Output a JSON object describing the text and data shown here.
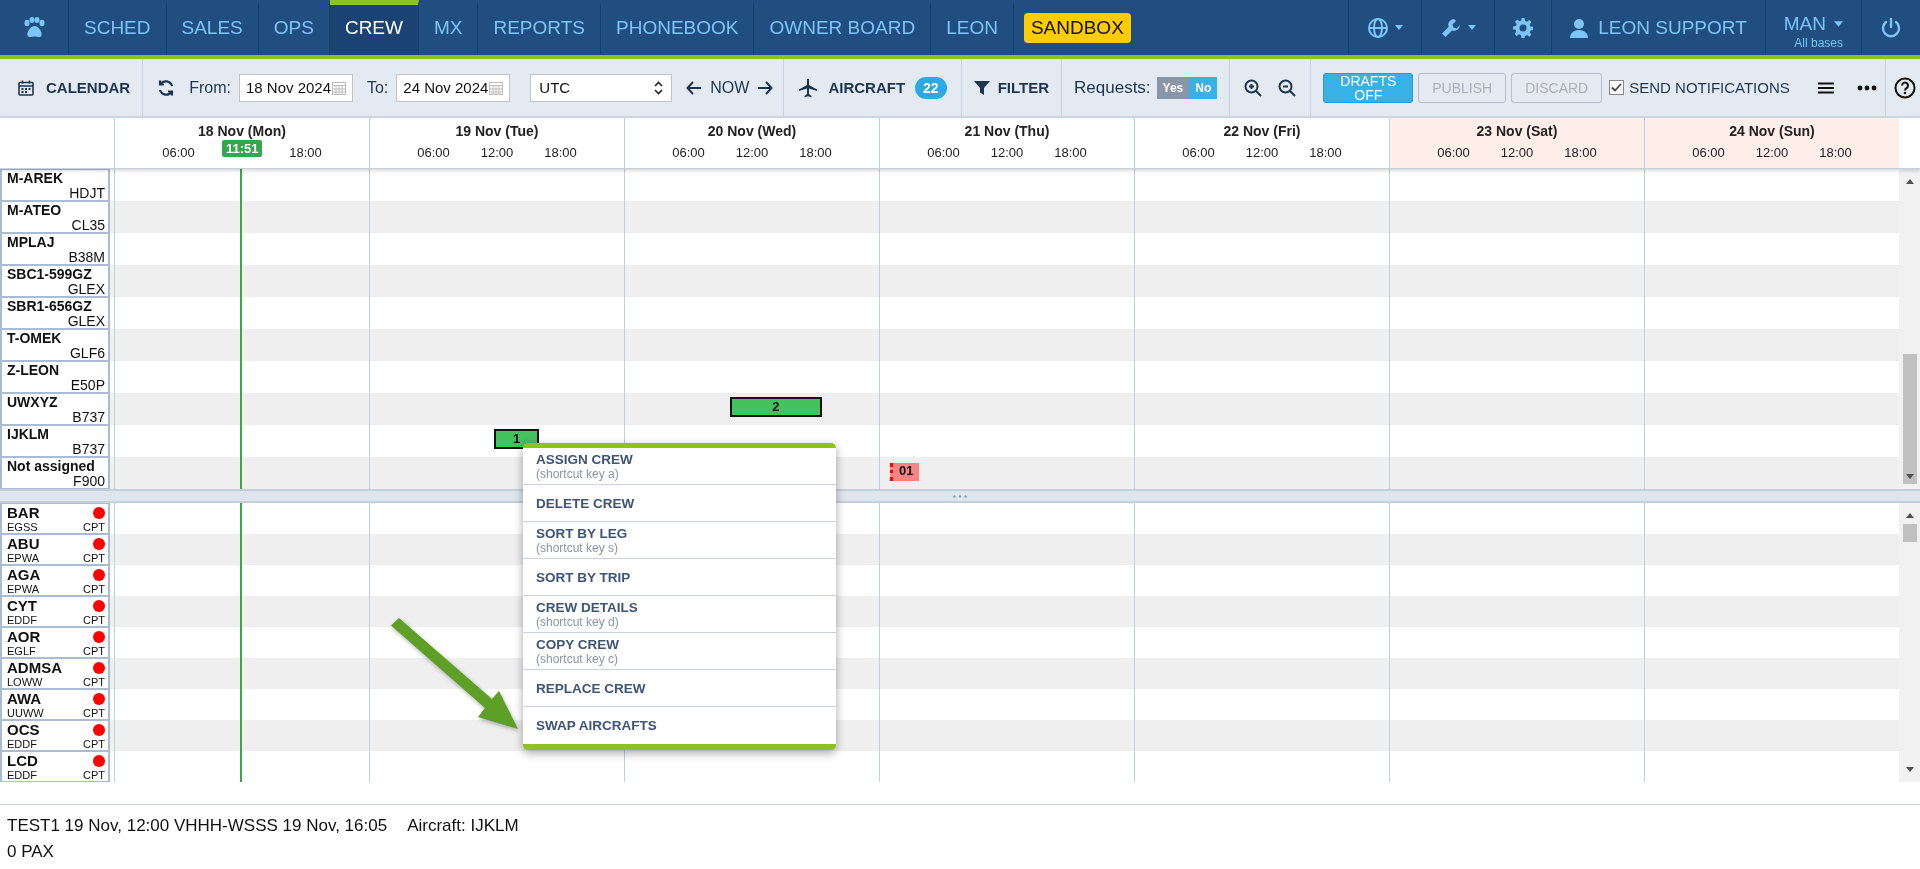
{
  "nav": {
    "items": [
      {
        "label": "SCHED",
        "selected": false
      },
      {
        "label": "SALES",
        "selected": false
      },
      {
        "label": "OPS",
        "selected": false
      },
      {
        "label": "CREW",
        "selected": true
      },
      {
        "label": "MX",
        "selected": false
      },
      {
        "label": "REPORTS",
        "selected": false
      },
      {
        "label": "PHONEBOOK",
        "selected": false
      },
      {
        "label": "OWNER BOARD",
        "selected": false
      },
      {
        "label": "LEON",
        "selected": false
      }
    ],
    "badge": "SANDBOX",
    "user": "LEON SUPPORT",
    "base": "MAN",
    "base_sub": "All bases"
  },
  "toolbar": {
    "calendar": "CALENDAR",
    "from_label": "From:",
    "from_value": "18 Nov 2024",
    "to_label": "To:",
    "to_value": "24 Nov 2024",
    "timezone": "UTC",
    "now": "NOW",
    "aircraft": "AIRCRAFT",
    "aircraft_count": "22",
    "filter": "FILTER",
    "requests_label": "Requests:",
    "requests": [
      {
        "label": "Yes",
        "selected": false
      },
      {
        "label": "No",
        "selected": true
      }
    ],
    "drafts": "DRAFTS OFF",
    "publish": {
      "label": "PUBLISH",
      "disabled": true
    },
    "discard": {
      "label": "DISCARD",
      "disabled": true
    },
    "notifications": {
      "label": "SEND NOTIFICATIONS",
      "checked": true
    }
  },
  "timeline": {
    "now_label": "11:51",
    "days": [
      {
        "label": "18 Nov (Mon)",
        "weekend": false,
        "ticks": [
          "06:00",
          "18:00"
        ]
      },
      {
        "label": "19 Nov (Tue)",
        "weekend": false,
        "ticks": [
          "06:00",
          "12:00",
          "18:00"
        ]
      },
      {
        "label": "20 Nov (Wed)",
        "weekend": false,
        "ticks": [
          "06:00",
          "12:00",
          "18:00"
        ]
      },
      {
        "label": "21 Nov (Thu)",
        "weekend": false,
        "ticks": [
          "06:00",
          "12:00",
          "18:00"
        ]
      },
      {
        "label": "22 Nov (Fri)",
        "weekend": false,
        "ticks": [
          "06:00",
          "12:00",
          "18:00"
        ]
      },
      {
        "label": "23 Nov (Sat)",
        "weekend": true,
        "ticks": [
          "06:00",
          "12:00",
          "18:00"
        ]
      },
      {
        "label": "24 Nov (Sun)",
        "weekend": true,
        "ticks": [
          "06:00",
          "12:00",
          "18:00"
        ]
      }
    ]
  },
  "aircraft": [
    {
      "name": "M-AREK",
      "type": "HDJT"
    },
    {
      "name": "M-ATEO",
      "type": "CL35"
    },
    {
      "name": "MPLAJ",
      "type": "B38M"
    },
    {
      "name": "SBC1-599GZ",
      "type": "GLEX"
    },
    {
      "name": "SBR1-656GZ",
      "type": "GLEX"
    },
    {
      "name": "T-OMEK",
      "type": "GLF6"
    },
    {
      "name": "Z-LEON",
      "type": "E50P"
    },
    {
      "name": "UWXYZ",
      "type": "B737",
      "events": [
        {
          "label": "2",
          "kind": "flight"
        }
      ]
    },
    {
      "name": "IJKLM",
      "type": "B737",
      "events": [
        {
          "label": "1",
          "kind": "flight"
        }
      ]
    },
    {
      "name": "Not assigned",
      "type": "F900",
      "events": [
        {
          "label": "01",
          "kind": "request"
        }
      ]
    }
  ],
  "crew": [
    {
      "code": "BAR",
      "base": "EGSS",
      "rank": "CPT",
      "color": "#ff0000"
    },
    {
      "code": "ABU",
      "base": "EPWA",
      "rank": "CPT",
      "color": "#ff0000"
    },
    {
      "code": "AGA",
      "base": "EPWA",
      "rank": "CPT",
      "color": "#ff0000"
    },
    {
      "code": "CYT",
      "base": "EDDF",
      "rank": "CPT",
      "color": "#ff0000"
    },
    {
      "code": "AOR",
      "base": "EGLF",
      "rank": "CPT",
      "color": "#ff0000"
    },
    {
      "code": "ADMSA",
      "base": "LOWW",
      "rank": "CPT",
      "color": "#ff0000"
    },
    {
      "code": "AWA",
      "base": "UUWW",
      "rank": "CPT",
      "color": "#ff0000"
    },
    {
      "code": "OCS",
      "base": "EDDF",
      "rank": "CPT",
      "color": "#ff0000"
    },
    {
      "code": "LCD",
      "base": "EDDF",
      "rank": "CPT",
      "color": "#ff0000"
    }
  ],
  "context_menu": [
    {
      "label": "ASSIGN CREW",
      "hint": "(shortcut key a)"
    },
    {
      "label": "DELETE CREW"
    },
    {
      "label": "SORT BY LEG",
      "hint": "(shortcut key s)"
    },
    {
      "label": "SORT BY TRIP"
    },
    {
      "label": "CREW DETAILS",
      "hint": "(shortcut key d)"
    },
    {
      "label": "COPY CREW",
      "hint": "(shortcut key c)"
    },
    {
      "label": "REPLACE CREW"
    },
    {
      "label": "SWAP AIRCRAFTS"
    }
  ],
  "info": {
    "flight": "TEST1 19 Nov, 12:00 VHHH-WSSS 19 Nov, 16:05",
    "aircraft": "Aircraft: IJKLM",
    "pax": "0 PAX"
  }
}
